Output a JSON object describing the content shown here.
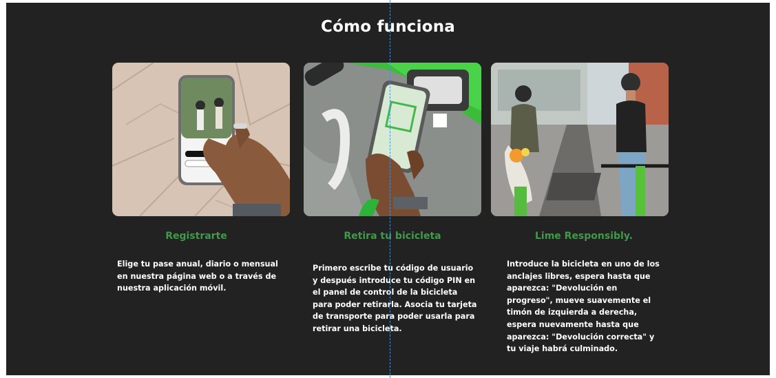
{
  "section": {
    "title": "Cómo funciona"
  },
  "steps": [
    {
      "title": "Registrarte",
      "text": "Elige tu pase anual, diario o mensual en nuestra página web o a través de nuestra aplicación móvil.",
      "image": "hand-holding-phone-app"
    },
    {
      "title": "Retira tu bicicleta",
      "text": "Primero escribe tu código de usuario y después introduce tu código PIN en el panel de control de la bicicleta para poder retirarla. Asocia tu tarjeta de transporte para poder usarla para retirar una bicicleta.",
      "image": "phone-scanning-bike-panel"
    },
    {
      "title": "Lime Responsibly.",
      "text": "Introduce la bicicleta en uno de los anclajes libres, espera hasta que aparezca: \"Devolución en progreso\", mueve suavemente el timón de izquierda a derecha, espera nuevamente hasta que aparezca: \"Devolución correcta\" y tu viaje habrá culminado.",
      "image": "two-riders-on-street"
    }
  ],
  "colors": {
    "background": "#222222",
    "accent": "#3f9b4a",
    "text": "#ffffff"
  }
}
